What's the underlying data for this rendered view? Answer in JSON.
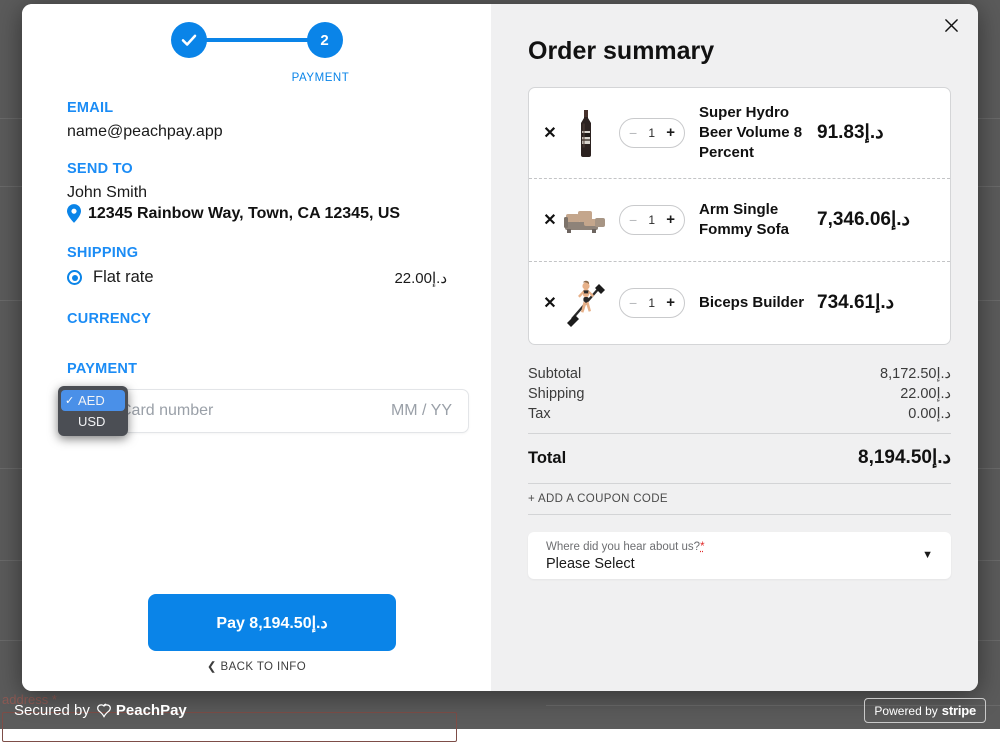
{
  "background": {
    "ghost_text_address": "address *"
  },
  "steps": {
    "step1_icon": "check-icon",
    "step2_number": "2",
    "current_label": "PAYMENT"
  },
  "form": {
    "email_heading": "EMAIL",
    "email_value": "name@peachpay.app",
    "send_to_heading": "SEND TO",
    "recipient_name": "John Smith",
    "address": "12345 Rainbow Way, Town, CA 12345, US",
    "shipping_heading": "SHIPPING",
    "shipping_option": "Flat rate",
    "shipping_price": "22.00د.إ",
    "currency_heading": "CURRENCY",
    "payment_heading": "PAYMENT",
    "card_number_placeholder": "Card number",
    "card_expiry_placeholder": "MM / YY",
    "pay_button": "Pay 8,194.50د.إ",
    "back_link": "❮ BACK TO INFO"
  },
  "currency_popup": {
    "options": [
      {
        "label": "AED",
        "selected": true
      },
      {
        "label": "USD",
        "selected": false
      }
    ],
    "check_glyph": "✓",
    "highlight_color": "#4a90e8",
    "background_color": "#4b4e54"
  },
  "summary": {
    "title": "Order summary",
    "close_icon": "close-icon",
    "items": [
      {
        "remove_glyph": "✕",
        "thumb": "beer-bottle-thumb",
        "qty": "1",
        "name": "Super Hydro Beer Volume 8 Percent",
        "price": "91.83د.إ"
      },
      {
        "remove_glyph": "✕",
        "thumb": "sofa-thumb",
        "qty": "1",
        "name": "Arm Single Fommy Sofa",
        "price": "7,346.06د.إ"
      },
      {
        "remove_glyph": "✕",
        "thumb": "fitness-thumb",
        "qty": "1",
        "name": "Biceps Builder",
        "price": "734.61د.إ"
      }
    ],
    "totals": [
      {
        "label": "Subtotal",
        "value": "8,172.50د.إ"
      },
      {
        "label": "Shipping",
        "value": "22.00د.إ"
      },
      {
        "label": "Tax",
        "value": "0.00د.إ"
      }
    ],
    "grand_total_label": "Total",
    "grand_total_value": "8,194.50د.إ",
    "coupon_link": "+ ADD A COUPON CODE",
    "referral_label": "Where did you hear about us?",
    "referral_required_mark": "*",
    "referral_value": "Please Select",
    "referral_caret": "▼"
  },
  "footer": {
    "secured_by": "Secured by",
    "brand": "PeachPay",
    "stripe_prefix": "Powered by",
    "stripe_word": "stripe"
  },
  "colors": {
    "accent": "#0a84e8",
    "heading_blue": "#1b8cf5",
    "summary_bg": "#f0f0f1",
    "required_red": "#e02b2b"
  }
}
